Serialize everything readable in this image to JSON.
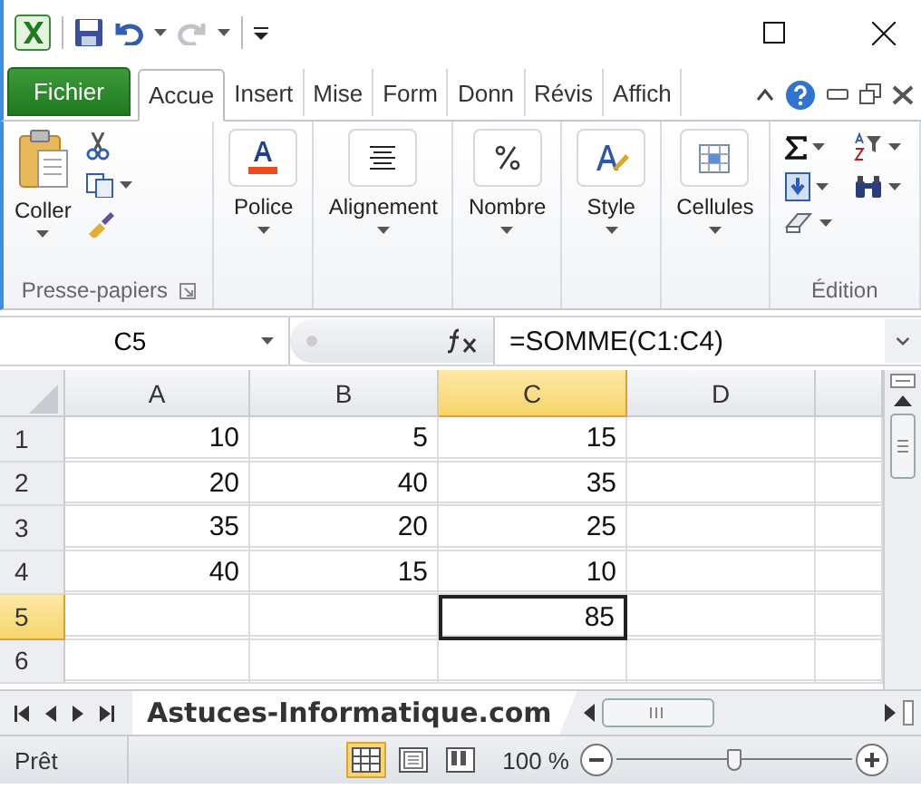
{
  "tabs": [
    {
      "label": "Fichier",
      "kind": "file",
      "selected": false
    },
    {
      "label": "Accue",
      "kind": "tab",
      "selected": true
    },
    {
      "label": "Insert",
      "kind": "tab",
      "selected": false
    },
    {
      "label": "Mise",
      "kind": "tab",
      "selected": false
    },
    {
      "label": "Form",
      "kind": "tab",
      "selected": false
    },
    {
      "label": "Donn",
      "kind": "tab",
      "selected": false
    },
    {
      "label": "Révis",
      "kind": "tab",
      "selected": false
    },
    {
      "label": "Affich",
      "kind": "tab",
      "selected": false
    }
  ],
  "ribbon": {
    "groups": [
      {
        "kind": "clipboard",
        "button": "Coller",
        "label": "Presse-papiers"
      },
      {
        "kind": "single",
        "button": "Police"
      },
      {
        "kind": "single",
        "button": "Alignement"
      },
      {
        "kind": "single",
        "button": "Nombre"
      },
      {
        "kind": "single",
        "button": "Style"
      },
      {
        "kind": "single",
        "button": "Cellules"
      },
      {
        "kind": "editing",
        "label": "Édition"
      }
    ]
  },
  "formula_bar": {
    "name_box": "C5",
    "formula": "=SOMME(C1:C4)"
  },
  "grid": {
    "columns": [
      {
        "label": "A",
        "selected": false
      },
      {
        "label": "B",
        "selected": false
      },
      {
        "label": "C",
        "selected": true
      },
      {
        "label": "D",
        "selected": false
      }
    ],
    "rows": [
      {
        "header": "1",
        "selected": false,
        "cells": {
          "A": "10",
          "B": "5",
          "C": "15"
        }
      },
      {
        "header": "2",
        "selected": false,
        "cells": {
          "A": "20",
          "B": "40",
          "C": "35"
        }
      },
      {
        "header": "3",
        "selected": false,
        "cells": {
          "A": "35",
          "B": "20",
          "C": "25"
        }
      },
      {
        "header": "4",
        "selected": false,
        "cells": {
          "A": "40",
          "B": "15",
          "C": "10"
        }
      },
      {
        "header": "5",
        "selected": true,
        "cells": {
          "C": "85"
        }
      },
      {
        "header": "6",
        "selected": false,
        "cells": {}
      }
    ]
  },
  "sheet_tabs": [
    {
      "label": "Astuces-Informatique.com",
      "selected": true
    }
  ],
  "status_bar": {
    "status": "Prêt",
    "views": [
      {
        "selected": true
      },
      {
        "selected": false
      },
      {
        "selected": false
      }
    ],
    "zoom": "100 %",
    "zoom_slider": {
      "level": 0.5
    }
  }
}
